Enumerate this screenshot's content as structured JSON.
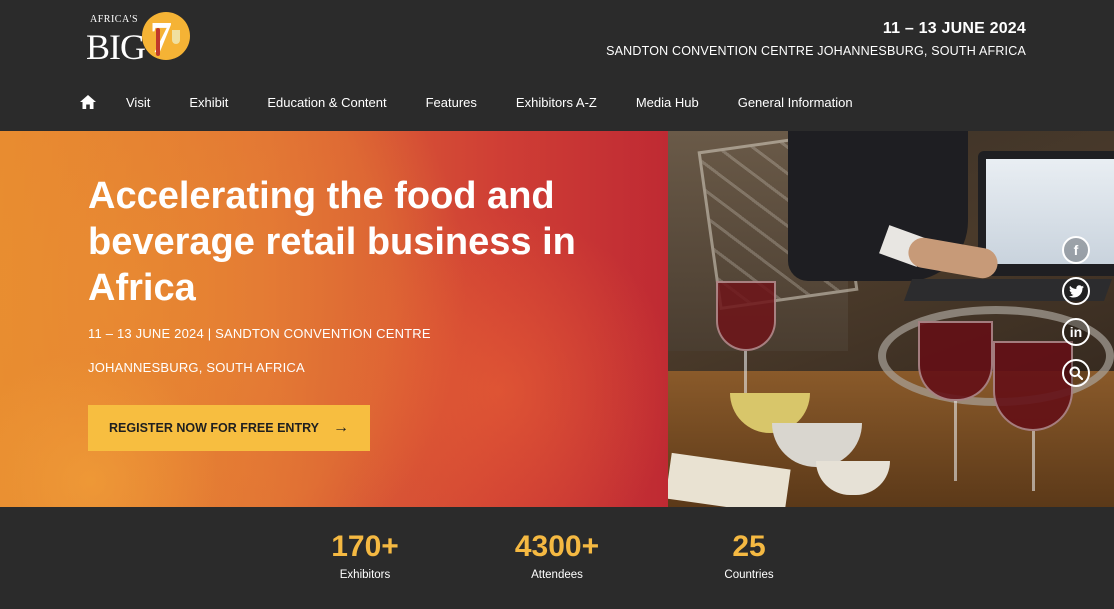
{
  "brand": {
    "logo_small": "AFRICA'S",
    "logo_big": "BIG",
    "logo_seven": "7"
  },
  "header": {
    "dates": "11 – 13 JUNE 2024",
    "venue": "SANDTON CONVENTION CENTRE JOHANNESBURG, SOUTH AFRICA"
  },
  "nav": {
    "home_icon": "home-icon",
    "items": [
      "Visit",
      "Exhibit",
      "Education & Content",
      "Features",
      "Exhibitors A-Z",
      "Media Hub",
      "General Information"
    ]
  },
  "hero": {
    "headline": "Accelerating the food and beverage retail business in Africa",
    "sub_line1": "11 – 13 JUNE 2024 | SANDTON CONVENTION CENTRE",
    "sub_line2": "JOHANNESBURG, SOUTH AFRICA",
    "cta_label": "REGISTER NOW FOR FREE ENTRY",
    "cta_arrow": "→"
  },
  "social": {
    "facebook": "f",
    "twitter": "twitter-icon",
    "linkedin": "in",
    "search": "search-icon"
  },
  "stats": [
    {
      "value": "170+",
      "label": "Exhibitors"
    },
    {
      "value": "4300+",
      "label": "Attendees"
    },
    {
      "value": "25",
      "label": "Countries"
    }
  ],
  "colors": {
    "accent": "#f7be40",
    "header_bg": "#2b2b2b",
    "hero_gradient_start": "#e6872f",
    "hero_gradient_end": "#bf2a33"
  }
}
